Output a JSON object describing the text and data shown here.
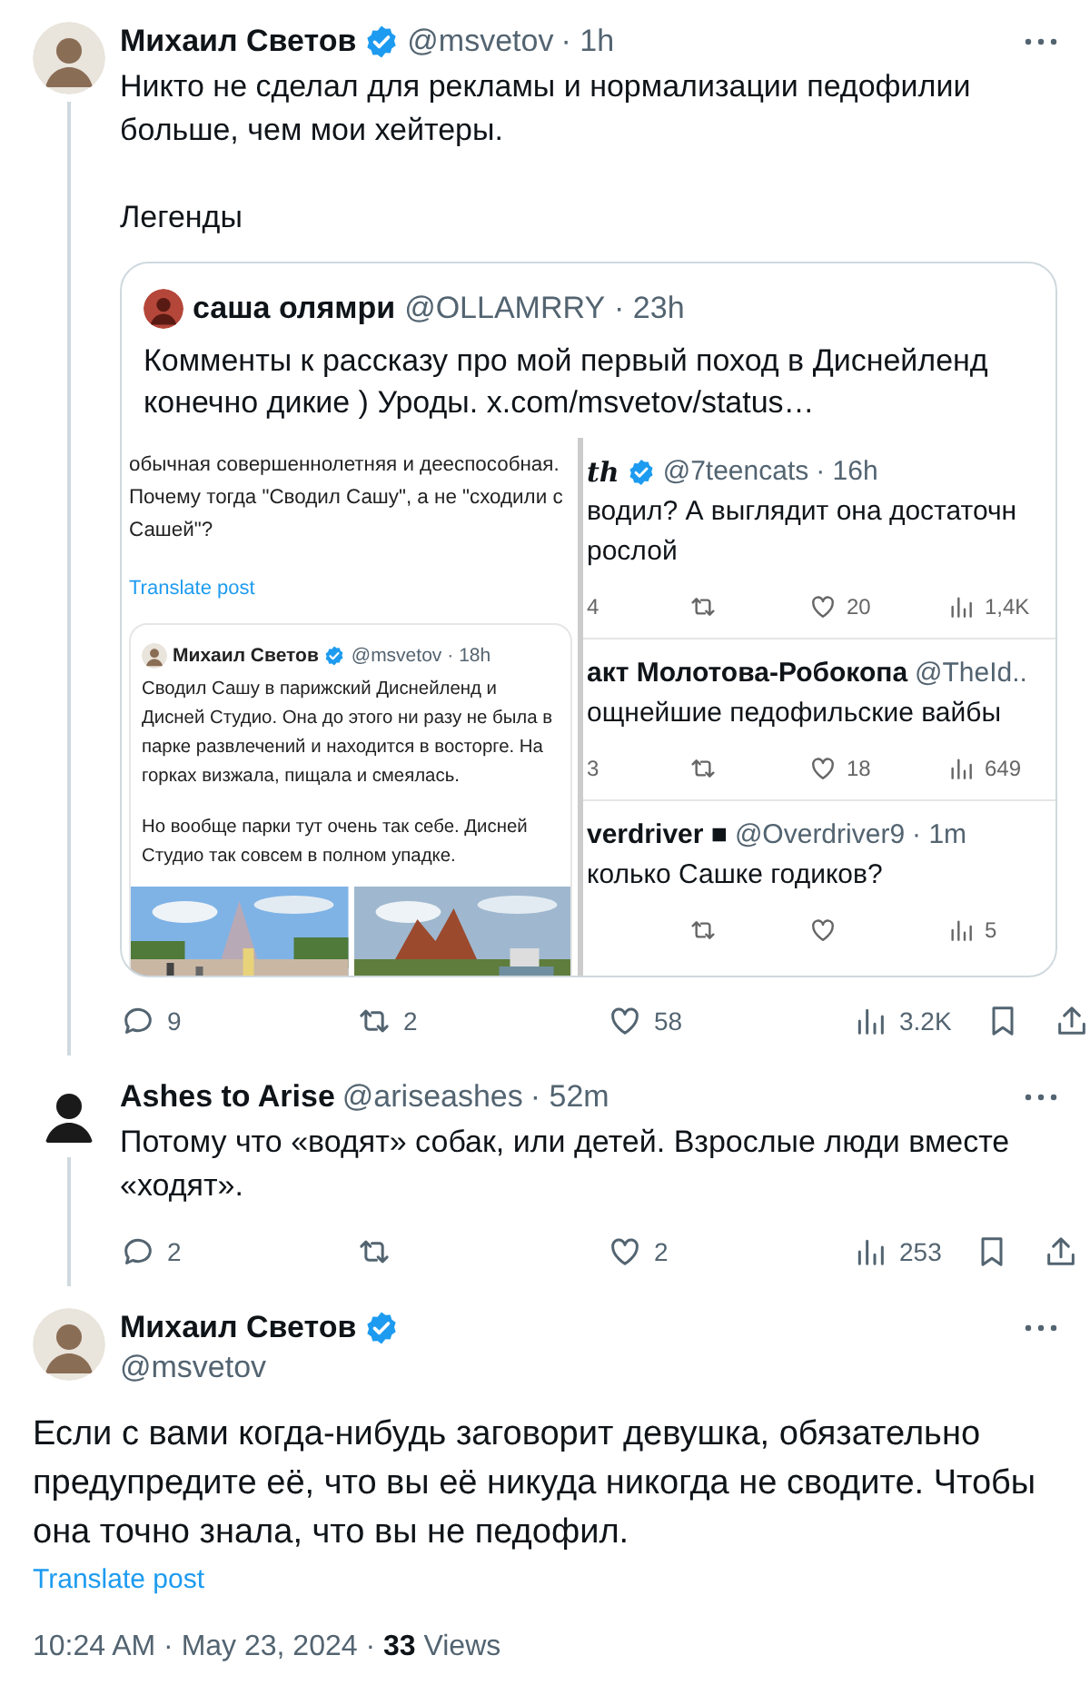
{
  "thread": [
    {
      "kind": "tweet",
      "author": "Михаил Светов",
      "verified": true,
      "handle": "@msvetov",
      "time": "· 1h",
      "paragraphs": [
        "Никто не сделал для рекламы и нормализации педофилии больше, чем мои хейтеры.",
        "Легенды"
      ],
      "quote": {
        "author": "саша олямри",
        "handle": "@OLLAMRRY",
        "time": "· 23h",
        "text": "Комменты к рассказу про мой первый поход в Диснейленд конечно дикие ) Уроды.",
        "link": "x.com/msvetov/status…",
        "screenshot": {
          "text": "обычная совершеннолетняя и дееспособная. Почему тогда \"Сводил Сашу\", а не \"сходили с Сашей\"?",
          "translate": "Translate post",
          "post": {
            "author": "Михаил Светов",
            "verified": true,
            "handle": "@msvetov",
            "time": "· 18h",
            "paragraphs": [
              "Сводил Сашу в парижский Диснейленд и Дисней Студио. Она до этого ни разу не была в парке развлечений и находится в восторге. На горках визжала, пищала и смеялась.",
              "Но вообще парки тут очень так себе. Дисней Студио так совсем в полном упадке."
            ]
          },
          "replies": [
            {
              "author": "th",
              "verified": true,
              "handle": "@7teencats",
              "time": "· 16h",
              "lines": [
                "водил? А выглядит она достаточн",
                "рослой"
              ],
              "actions": [
                {
                  "kind": "reply",
                  "count": "4"
                },
                {
                  "kind": "retweet"
                },
                {
                  "kind": "like",
                  "count": "20"
                },
                {
                  "kind": "views",
                  "count": "1,4K"
                }
              ]
            },
            {
              "author": "акт Молотова-Робокопа",
              "verified": false,
              "handle": "@TheId..",
              "lines": [
                "ощнейшие педофильские вайбы"
              ],
              "actions": [
                {
                  "kind": "reply",
                  "count": "3"
                },
                {
                  "kind": "retweet"
                },
                {
                  "kind": "like",
                  "count": "18"
                },
                {
                  "kind": "views",
                  "count": "649"
                }
              ]
            },
            {
              "author": "verdriver ■",
              "verified": false,
              "handle": "@Overdriver9",
              "time": "· 1m",
              "lines": [
                "колько Сашке годиков?"
              ],
              "actions": [
                {
                  "kind": "reply"
                },
                {
                  "kind": "retweet"
                },
                {
                  "kind": "like"
                },
                {
                  "kind": "views",
                  "count": "5"
                }
              ]
            }
          ]
        }
      },
      "actions": [
        {
          "kind": "reply",
          "count": "9"
        },
        {
          "kind": "retweet",
          "count": "2"
        },
        {
          "kind": "like",
          "count": "58"
        },
        {
          "kind": "views",
          "count": "3.2K"
        },
        {
          "kind": "bookmark"
        },
        {
          "kind": "share"
        }
      ]
    },
    {
      "kind": "tweet",
      "author": "Ashes to Arise",
      "verified": false,
      "handle": "@ariseashes",
      "time": "· 52m",
      "paragraphs": [
        "Потому что «водят» собак, или детей. Взрослые люди вместе «ходят»."
      ],
      "actions": [
        {
          "kind": "reply",
          "count": "2"
        },
        {
          "kind": "retweet"
        },
        {
          "kind": "like",
          "count": "2"
        },
        {
          "kind": "views",
          "count": "253"
        },
        {
          "kind": "bookmark"
        },
        {
          "kind": "share"
        }
      ]
    },
    {
      "kind": "focused",
      "author": "Михаил Светов",
      "verified": true,
      "handle": "@msvetov",
      "paragraphs": [
        "Если с вами когда-нибудь заговорит девушка, обязательно предупредите её, что вы её никуда никогда не сводите. Чтобы она точно знала, что вы не педофил."
      ],
      "translate": "Translate post",
      "meta": "10:24 AM · May 23, 2024 · **33** Views"
    }
  ]
}
